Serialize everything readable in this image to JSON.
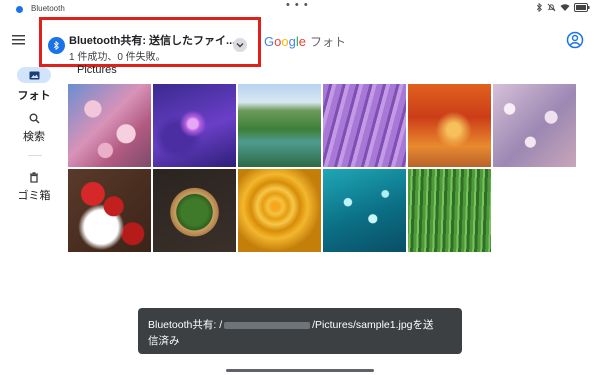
{
  "status_bar": {
    "app_name": "Bluetooth",
    "center_dots": "• • •"
  },
  "app_bar": {
    "brand_google": "Google",
    "brand_photos": "フォト"
  },
  "notification": {
    "title": "Bluetooth共有: 送信したファイ...",
    "text": "1 件成功、0 件失敗。",
    "highlight_color": "#e0201b",
    "icon": "bluetooth-icon"
  },
  "nav": {
    "items": [
      {
        "label": "フォト",
        "icon": "photo-icon",
        "selected": true
      },
      {
        "label": "検索",
        "icon": "search-icon",
        "selected": false
      },
      {
        "label": "ゴミ箱",
        "icon": "trash-icon",
        "selected": false
      }
    ]
  },
  "gallery": {
    "section_title": "Pictures",
    "photos": [
      {
        "subject": "cherry-blossoms"
      },
      {
        "subject": "purple-flower-water"
      },
      {
        "subject": "mountain-lake"
      },
      {
        "subject": "lavender-field"
      },
      {
        "subject": "autumn-forest"
      },
      {
        "subject": "bokeh-lights"
      },
      {
        "subject": "strawberries"
      },
      {
        "subject": "basil-bowl"
      },
      {
        "subject": "yellow-rose"
      },
      {
        "subject": "water-bubbles"
      },
      {
        "subject": "grass-dew"
      }
    ]
  },
  "toast": {
    "prefix": "Bluetooth共有: /",
    "suffix": "/Pictures/sample1.jpgを送",
    "line2": "信済み"
  },
  "colors": {
    "accent": "#1a73e8",
    "toast_bg": "#3c4043"
  }
}
